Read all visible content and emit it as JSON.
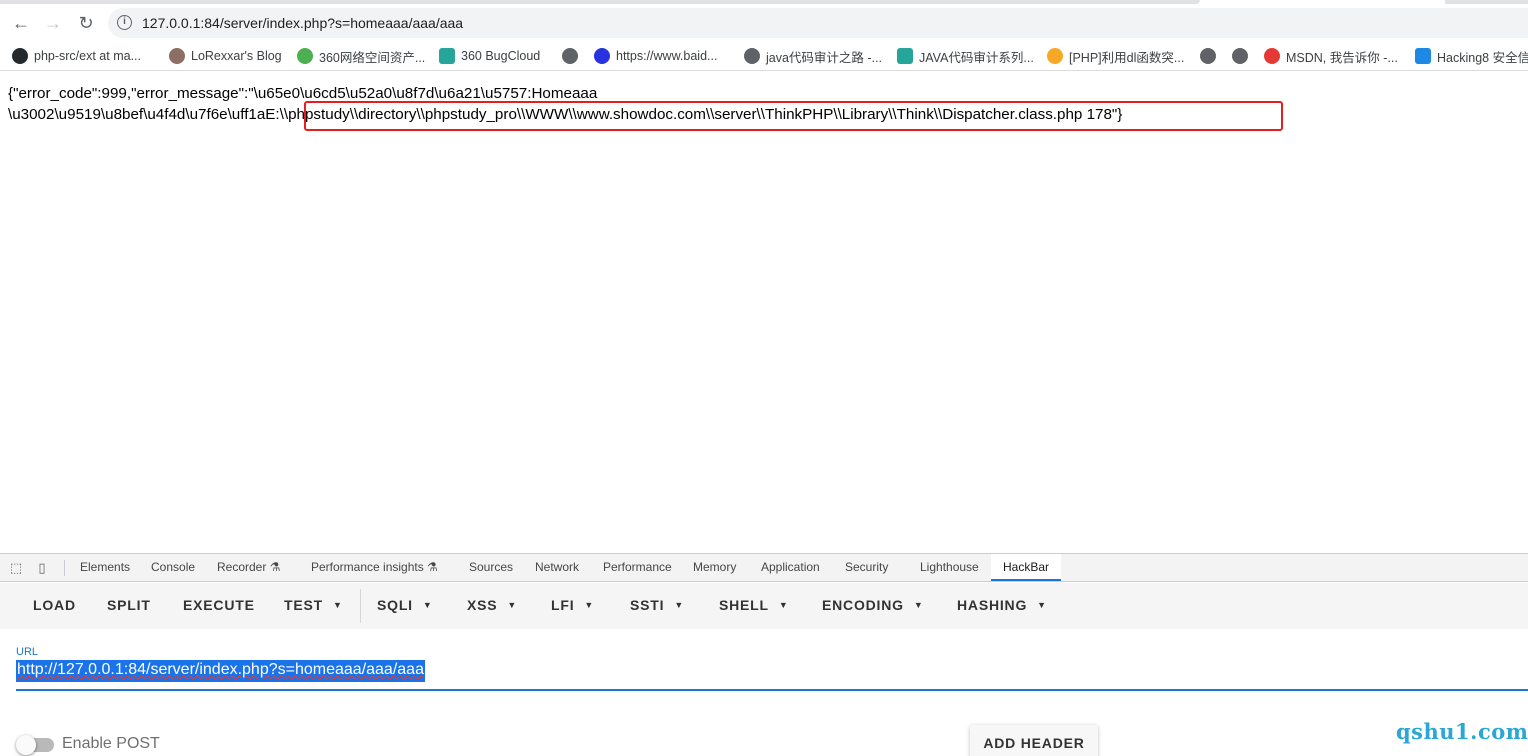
{
  "browser": {
    "url": "127.0.0.1:84/server/index.php?s=homeaaa/aaa/aaa",
    "nav": {
      "back": "←",
      "forward": "→",
      "reload": "↻",
      "info": "i"
    }
  },
  "bookmarks": [
    {
      "label": "php-src/ext at ma...",
      "icon": "github-icon",
      "color": "#24292e"
    },
    {
      "label": "LoRexxar's Blog",
      "icon": "blog-icon",
      "color": "#8d6e63"
    },
    {
      "label": "360网络空间资产...",
      "icon": "360-icon",
      "color": "#4caf50"
    },
    {
      "label": "360 BugCloud",
      "icon": "bugcloud-icon",
      "color": "#26a69a"
    },
    {
      "label": "",
      "icon": "globe-icon",
      "color": "#5f6368"
    },
    {
      "label": "https://www.baid...",
      "icon": "baidu-icon",
      "color": "#2932e1"
    },
    {
      "label": "java代码审计之路 -...",
      "icon": "java-icon",
      "color": "#5f6368"
    },
    {
      "label": "JAVA代码审计系列...",
      "icon": "doc-icon",
      "color": "#26a69a"
    },
    {
      "label": "[PHP]利用dl函数突...",
      "icon": "php-icon",
      "color": "#f9a825"
    },
    {
      "label": "",
      "icon": "globe-icon",
      "color": "#5f6368"
    },
    {
      "label": "",
      "icon": "globe-icon",
      "color": "#5f6368"
    },
    {
      "label": "MSDN, 我告诉你 -...",
      "icon": "msdn-icon",
      "color": "#e53935"
    },
    {
      "label": "Hacking8 安全信",
      "icon": "hacking8-icon",
      "color": "#1e88e5"
    }
  ],
  "page": {
    "line1": "{\"error_code\":999,\"error_message\":\"\\u65e0\\u6cd5\\u52a0\\u8f7d\\u6a21\\u5757:Homeaaa",
    "line2": "\\u3002\\u9519\\u8bef\\u4f4d\\u7f6e\\uff1aE:\\\\phpstudy\\\\directory\\\\phpstudy_pro\\\\WWW\\\\www.showdoc.com\\\\server\\\\ThinkPHP\\\\Library\\\\Think\\\\Dispatcher.class.php 178\"}"
  },
  "devtools": {
    "tabs": [
      "Elements",
      "Console",
      "Recorder ⚗",
      "Performance insights ⚗",
      "Sources",
      "Network",
      "Performance",
      "Memory",
      "Application",
      "Security",
      "Lighthouse",
      "HackBar"
    ],
    "active_tab": "HackBar"
  },
  "hackbar": {
    "menu": [
      {
        "label": "LOAD",
        "dropdown": false
      },
      {
        "label": "SPLIT",
        "dropdown": false
      },
      {
        "label": "EXECUTE",
        "dropdown": false
      },
      {
        "label": "TEST",
        "dropdown": true
      },
      {
        "label": "SQLI",
        "dropdown": true
      },
      {
        "label": "XSS",
        "dropdown": true
      },
      {
        "label": "LFI",
        "dropdown": true
      },
      {
        "label": "SSTI",
        "dropdown": true
      },
      {
        "label": "SHELL",
        "dropdown": true
      },
      {
        "label": "ENCODING",
        "dropdown": true
      },
      {
        "label": "HASHING",
        "dropdown": true
      }
    ],
    "url_label": "URL",
    "url_value": "http://127.0.0.1:84/server/index.php?s=homeaaa/aaa/aaa",
    "enable_post_label": "Enable POST",
    "enable_post": false,
    "add_header_label": "ADD HEADER"
  },
  "watermark": "qshu1.com"
}
